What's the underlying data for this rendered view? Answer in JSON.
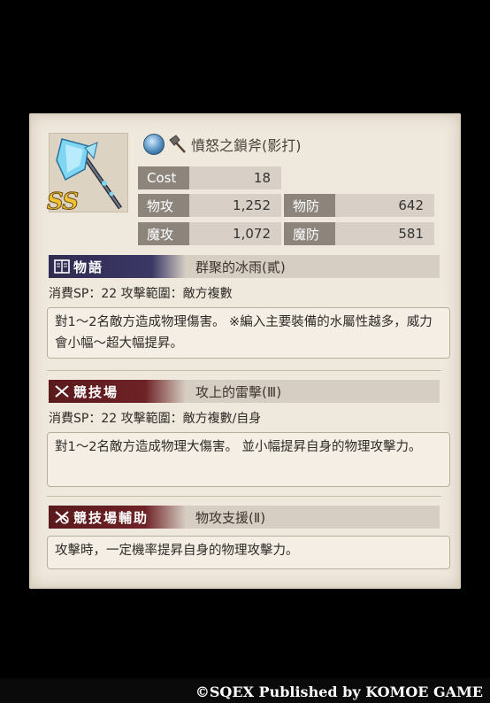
{
  "weapon": {
    "name": "憤怒之鎖斧(影打)",
    "rarity": "SS",
    "element_icon": "water-element-icon",
    "type_icon": "axe-icon"
  },
  "stats": {
    "cost_label": "Cost",
    "cost_value": "18",
    "patk_label": "物攻",
    "patk_value": "1,252",
    "pdef_label": "物防",
    "pdef_value": "642",
    "matk_label": "魔攻",
    "matk_value": "1,072",
    "mdef_label": "魔防",
    "mdef_value": "581"
  },
  "sections": {
    "story": {
      "tag": "物語",
      "skill": "群聚的冰雨(貳)",
      "meta": "消費SP：22 攻擊範圍：敵方複數",
      "desc": "對1～2名敵方造成物理傷害。 ※編入主要裝備的水屬性越多，威力會小幅～超大幅提昇。"
    },
    "arena": {
      "tag": "競技場",
      "skill": "攻上的雷擊(Ⅲ)",
      "meta": "消費SP：22 攻擊範圍：敵方複數/自身",
      "desc": "對1～2名敵方造成物理大傷害。 並小幅提昇自身的物理攻擊力。"
    },
    "arena_support": {
      "tag": "競技場輔助",
      "skill": "物攻支援(Ⅱ)",
      "desc": "攻擊時，一定機率提昇自身的物理攻擊力。"
    }
  },
  "footer": {
    "copyright": "©SQEX Published by KOMOE GAME"
  }
}
